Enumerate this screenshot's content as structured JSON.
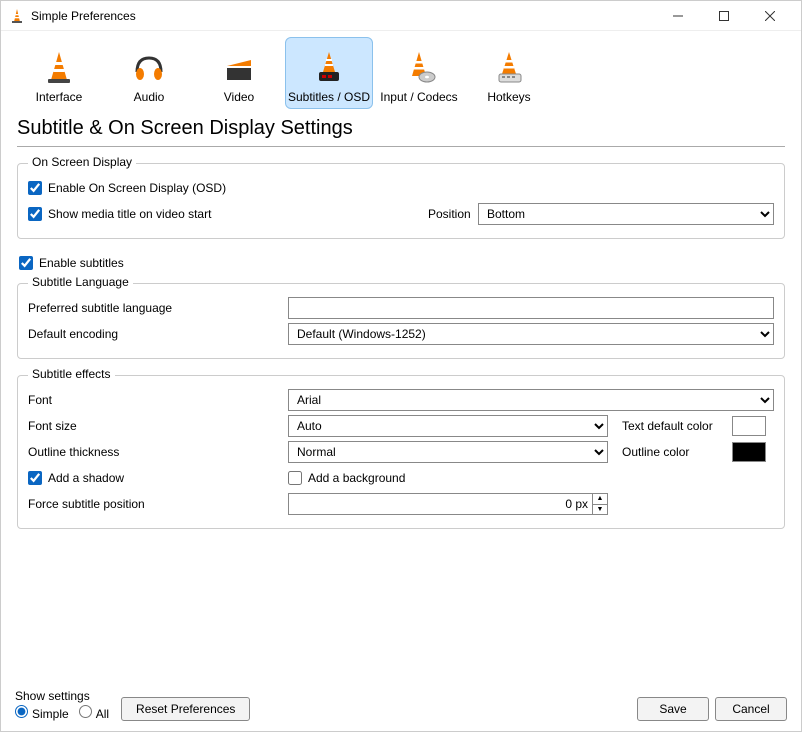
{
  "titlebar": {
    "title": "Simple Preferences"
  },
  "toolbar": {
    "items": [
      {
        "label": "Interface"
      },
      {
        "label": "Audio"
      },
      {
        "label": "Video"
      },
      {
        "label": "Subtitles / OSD",
        "selected": true
      },
      {
        "label": "Input / Codecs"
      },
      {
        "label": "Hotkeys"
      }
    ]
  },
  "heading": "Subtitle & On Screen Display Settings",
  "osd": {
    "group_title": "On Screen Display",
    "enable_osd": {
      "label": "Enable On Screen Display (OSD)",
      "checked": true
    },
    "show_title": {
      "label": "Show media title on video start",
      "checked": true
    },
    "position_label": "Position",
    "position_value": "Bottom"
  },
  "subtitles": {
    "enable": {
      "label": "Enable subtitles",
      "checked": true
    },
    "lang_group_title": "Subtitle Language",
    "preferred_label": "Preferred subtitle language",
    "preferred_value": "",
    "encoding_label": "Default encoding",
    "encoding_value": "Default (Windows-1252)"
  },
  "effects": {
    "group_title": "Subtitle effects",
    "font_label": "Font",
    "font_value": "Arial",
    "size_label": "Font size",
    "size_value": "Auto",
    "text_color_label": "Text default color",
    "text_color_value": "#ffffff",
    "outline_th_label": "Outline thickness",
    "outline_th_value": "Normal",
    "outline_color_label": "Outline color",
    "outline_color_value": "#000000",
    "shadow": {
      "label": "Add a shadow",
      "checked": true
    },
    "background": {
      "label": "Add a background",
      "checked": false
    },
    "force_pos_label": "Force subtitle position",
    "force_pos_value": "0 px"
  },
  "footer": {
    "show_label": "Show settings",
    "simple": "Simple",
    "all": "All",
    "reset": "Reset Preferences",
    "save": "Save",
    "cancel": "Cancel"
  }
}
